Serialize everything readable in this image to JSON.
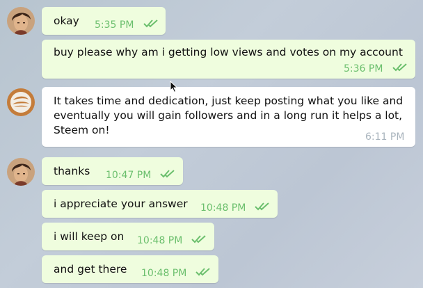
{
  "messages": [
    {
      "text": "okay",
      "time": "5:35 PM",
      "status_icon": "double-check-icon"
    },
    {
      "text": "buy please why am i getting low views and votes on my account",
      "time": "5:36 PM",
      "status_icon": "double-check-icon"
    },
    {
      "text": "It takes time and dedication, just keep posting what you like and eventually you will gain followers and in a long run it helps a lot, Steem on!",
      "time": "6:11 PM"
    },
    {
      "text": "thanks",
      "time": "10:47 PM",
      "status_icon": "double-check-icon"
    },
    {
      "text": "i appreciate your answer",
      "time": "10:48 PM",
      "status_icon": "double-check-icon"
    },
    {
      "text": "i will keep on",
      "time": "10:48 PM",
      "status_icon": "double-check-icon"
    },
    {
      "text": "and get there",
      "time": "10:48 PM",
      "status_icon": "double-check-icon"
    }
  ],
  "colors": {
    "outgoing_bubble": "#effdde",
    "incoming_bubble": "#ffffff",
    "read_check": "#6bbf6d",
    "incoming_time": "#a9b4bd"
  }
}
